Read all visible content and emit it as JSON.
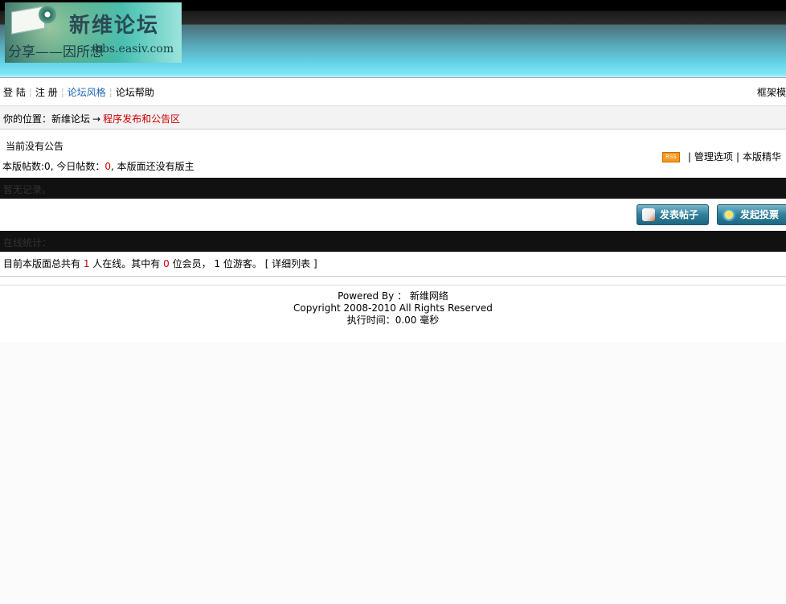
{
  "header": {
    "logo_title": "新维论坛",
    "logo_slogan": "分享——因所想",
    "logo_url": "bbs.easiv.com"
  },
  "nav": {
    "items": [
      {
        "label": "登 陆",
        "color": "#000000"
      },
      {
        "label": "注 册",
        "color": "#000000"
      },
      {
        "label": "论坛风格",
        "color": "#1c64b8"
      },
      {
        "label": "论坛帮助",
        "color": "#000000"
      }
    ],
    "right_label": "框架模"
  },
  "breadcrumb": {
    "prefix": "你的位置：",
    "home": "新维论坛",
    "arrow": "→",
    "current": "程序发布和公告区"
  },
  "announcement": {
    "notice": "当前没有公告",
    "stats_prefix": "本版帖数:",
    "posts": "0",
    "today_prefix": ", 今日帖数：",
    "today_posts": "0",
    "moderator_text": ", 本版面还没有版主",
    "rss_icon": "RSS",
    "tool_manage": "管理选项",
    "tool_digest": "本版精华"
  },
  "records_bar": {
    "text": "暂无记录。"
  },
  "buttons": {
    "post": "发表帖子",
    "vote": "发起投票"
  },
  "online_bar": {
    "title": "在线统计："
  },
  "online": {
    "prefix": "目前本版面总共有 ",
    "total": "1",
    "mid1": " 人在线。其中有 ",
    "members": "0",
    "mid2": " 位会员， ",
    "guests": "1",
    "suffix": " 位游客。",
    "detail_link": "[ 详细列表 ]"
  },
  "footer": {
    "powered": "Powered By ： 新维网络",
    "copyright": "Copyright 2008-2010 All Rights Reserved",
    "exec_time": "执行时间：0.00 毫秒"
  },
  "colors": {
    "accent_red": "#cc0000",
    "link_blue": "#1c64b8"
  }
}
